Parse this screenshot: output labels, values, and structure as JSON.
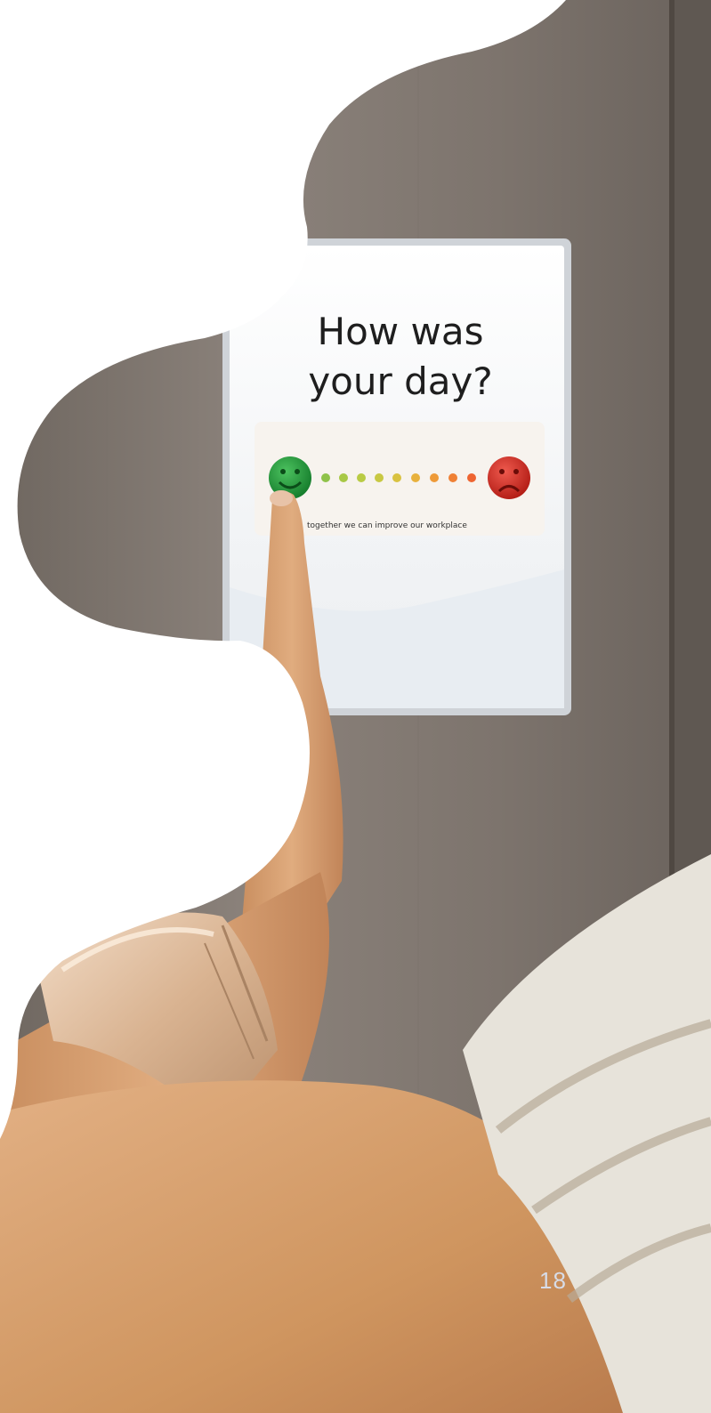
{
  "sign": {
    "title_line1": "How was",
    "title_line2": "your day?",
    "tagline": "together we can improve our workplace",
    "happy_color": "#1f9a3a",
    "sad_color": "#d42b22",
    "icons": [
      "happy-face-icon",
      "sad-face-icon"
    ]
  },
  "page": {
    "number": "18"
  },
  "colors": {
    "wall": "#8a8078",
    "skin": "#d39e6f",
    "shirt": "#e6e2d8"
  }
}
